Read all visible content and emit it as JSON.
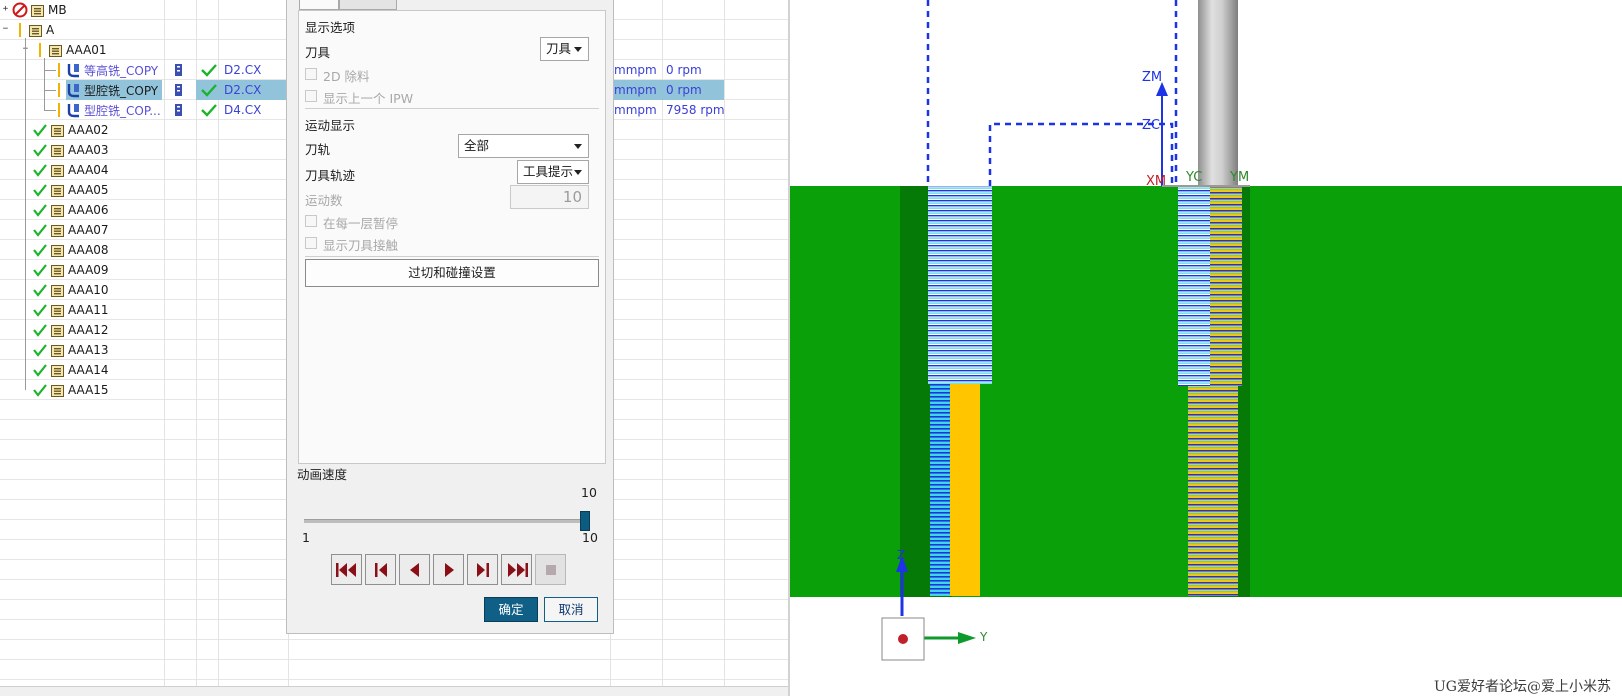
{
  "navigator": {
    "root": {
      "label": "MB"
    },
    "program": {
      "label": "A"
    },
    "groups": [
      {
        "label": "AAA01",
        "operations": [
          {
            "name": "等高铣_COPY",
            "tool": "D2.CX",
            "feed": "mmpm",
            "speed": "0 rpm"
          },
          {
            "name": "型腔铣_COPY",
            "tool": "D2.CX",
            "feed": "mmpm",
            "speed": "0 rpm"
          },
          {
            "name": "型腔铣_COP...",
            "tool": "D4.CX",
            "feed": "mmpm",
            "speed": "7958 rpm"
          }
        ]
      },
      {
        "label": "AAA02"
      },
      {
        "label": "AAA03"
      },
      {
        "label": "AAA04"
      },
      {
        "label": "AAA05"
      },
      {
        "label": "AAA06"
      },
      {
        "label": "AAA07"
      },
      {
        "label": "AAA08"
      },
      {
        "label": "AAA09"
      },
      {
        "label": "AAA10"
      },
      {
        "label": "AAA11"
      },
      {
        "label": "AAA12"
      },
      {
        "label": "AAA13"
      },
      {
        "label": "AAA14"
      },
      {
        "label": "AAA15"
      }
    ]
  },
  "dialog": {
    "display_options": {
      "heading": "显示选项",
      "tool_label": "刀具",
      "tool_value": "刀具",
      "remove_material": "2D 除料",
      "show_prev_ipw": "显示上一个 IPW"
    },
    "motion_display": {
      "heading": "运动显示",
      "path_label": "刀轨",
      "path_value": "全部",
      "tool_path_label": "刀具轨迹",
      "tool_path_value": "工具提示",
      "motion_count_label": "运动数",
      "motion_count_value": "10",
      "pause_each_layer": "在每一层暂停",
      "show_tool_contact": "显示刀具接触"
    },
    "overcut_button": "过切和碰撞设置",
    "animation": {
      "label": "动画速度",
      "value": "10",
      "min": "1",
      "max": "10",
      "fraction": 1.0
    },
    "playback": [
      "rewind-to-start",
      "step-back",
      "play-reverse",
      "play-forward",
      "step-forward",
      "fast-forward-to-end",
      "stop"
    ],
    "ok": "确定",
    "cancel": "取消"
  },
  "viewport": {
    "axis_labels": {
      "zm": "ZM",
      "zc": "ZC",
      "xm": "XM",
      "yc": "YC",
      "ym": "YM",
      "z": "Z",
      "y": "Y"
    },
    "colors": {
      "part": "#0aa00a",
      "toolpath": "#1c33e6",
      "cut_region": "#ffc600",
      "tool": "#b5b5b5"
    }
  },
  "watermark": "UG爱好者论坛@爱上小米苏"
}
